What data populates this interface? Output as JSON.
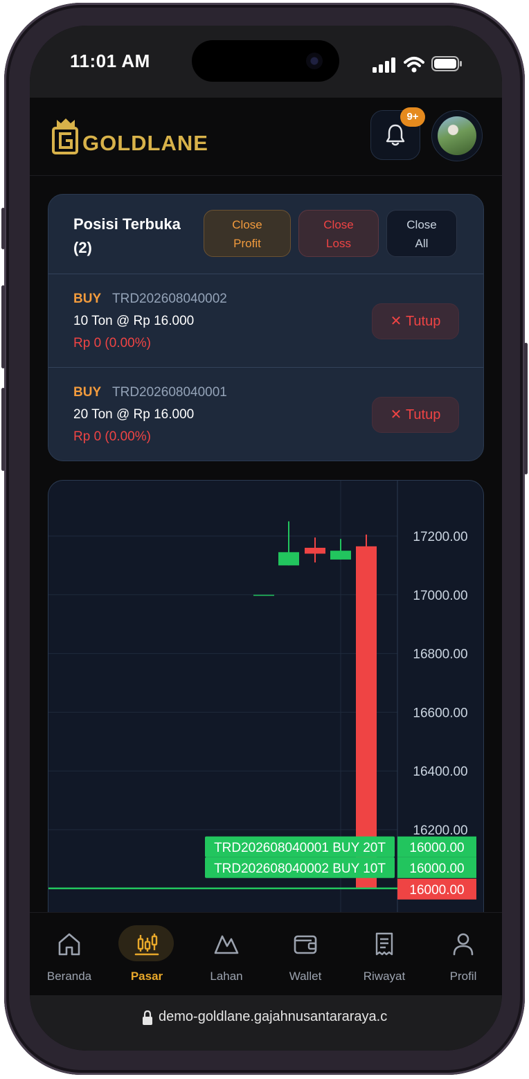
{
  "status": {
    "time": "11:01 AM"
  },
  "brand": {
    "name": "GOLDLANE",
    "accent": "#d8b24a"
  },
  "header": {
    "notification_badge": "9+"
  },
  "positions": {
    "title": "Posisi Terbuka",
    "count": "(2)",
    "close_profit": [
      "Close",
      "Profit"
    ],
    "close_loss": [
      "Close",
      "Loss"
    ],
    "close_all": [
      "Close",
      "All"
    ],
    "items": [
      {
        "side": "BUY",
        "trade_id": "TRD202608040002",
        "detail": "10 Ton @ Rp 16.000",
        "pnl": "Rp 0 (0.00%)",
        "close_label": "Tutup",
        "close_icon": "x-icon"
      },
      {
        "side": "BUY",
        "trade_id": "TRD202608040001",
        "detail": "20 Ton @ Rp 16.000",
        "pnl": "Rp 0 (0.00%)",
        "close_label": "Tutup",
        "close_icon": "x-icon"
      }
    ]
  },
  "chart_data": {
    "type": "candlestick",
    "y_ticks": [
      "17200.00",
      "17000.00",
      "16800.00",
      "16600.00",
      "16400.00",
      "16200.00"
    ],
    "ylim": [
      15940,
      17250
    ],
    "candles": [
      {
        "open": 17000,
        "high": 17000,
        "low": 17000,
        "close": 17000
      },
      {
        "open": 17100,
        "high": 17250,
        "low": 17100,
        "close": 17145
      },
      {
        "open": 17160,
        "high": 17195,
        "low": 17110,
        "close": 17140
      },
      {
        "open": 17120,
        "high": 17190,
        "low": 17120,
        "close": 17150
      },
      {
        "open": 17165,
        "high": 17205,
        "low": 16000,
        "close": 16000
      }
    ],
    "price_lines": [
      {
        "label": "TRD202608040001 BUY 20T",
        "price": "16000.00",
        "value": 16000,
        "color": "#22c55e"
      },
      {
        "label": "TRD202608040002 BUY 10T",
        "price": "16000.00",
        "value": 16000,
        "color": "#22c55e"
      }
    ],
    "current_price": {
      "price": "16000.00",
      "value": 16000,
      "color": "#ef4444"
    },
    "up_color": "#22c55e",
    "down_color": "#ef4444"
  },
  "nav": {
    "items": [
      {
        "label": "Beranda",
        "icon": "home-icon",
        "active": false
      },
      {
        "label": "Pasar",
        "icon": "candles-icon",
        "active": true
      },
      {
        "label": "Lahan",
        "icon": "mountain-icon",
        "active": false
      },
      {
        "label": "Wallet",
        "icon": "wallet-icon",
        "active": false
      },
      {
        "label": "Riwayat",
        "icon": "receipt-icon",
        "active": false
      },
      {
        "label": "Profil",
        "icon": "user-icon",
        "active": false
      }
    ]
  },
  "browser": {
    "url": "demo-goldlane.gajahnusantararaya.c"
  }
}
